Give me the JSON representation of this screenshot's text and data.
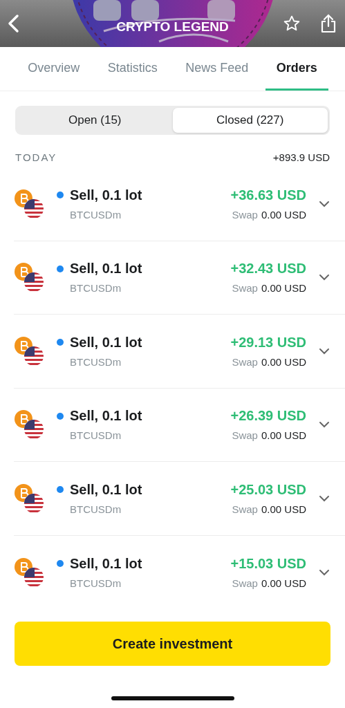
{
  "header": {
    "title": "CRYPTO LEGEND"
  },
  "tabs": [
    {
      "label": "Overview",
      "selected": false
    },
    {
      "label": "Statistics",
      "selected": false
    },
    {
      "label": "News Feed",
      "selected": false
    },
    {
      "label": "Orders",
      "selected": true
    }
  ],
  "segments": [
    {
      "label": "Open (15)",
      "selected": false
    },
    {
      "label": "Closed (227)",
      "selected": true
    }
  ],
  "section": {
    "label": "TODAY",
    "total": "+893.9 USD"
  },
  "orders": [
    {
      "title": "Sell, 0.1 lot",
      "color": "#1e88f0",
      "symbol": "BTCUSDm",
      "profit": "+36.63 USD",
      "swap_label": "Swap",
      "swap_value": "0.00 USD"
    },
    {
      "title": "Sell, 0.1 lot",
      "color": "#1e88f0",
      "symbol": "BTCUSDm",
      "profit": "+32.43 USD",
      "swap_label": "Swap",
      "swap_value": "0.00 USD"
    },
    {
      "title": "Sell, 0.1 lot",
      "color": "#1e88f0",
      "symbol": "BTCUSDm",
      "profit": "+29.13 USD",
      "swap_label": "Swap",
      "swap_value": "0.00 USD"
    },
    {
      "title": "Sell, 0.1 lot",
      "color": "#1e88f0",
      "symbol": "BTCUSDm",
      "profit": "+26.39 USD",
      "swap_label": "Swap",
      "swap_value": "0.00 USD"
    },
    {
      "title": "Sell, 0.1 lot",
      "color": "#1e88f0",
      "symbol": "BTCUSDm",
      "profit": "+25.03 USD",
      "swap_label": "Swap",
      "swap_value": "0.00 USD"
    },
    {
      "title": "Sell, 0.1 lot",
      "color": "#1e88f0",
      "symbol": "BTCUSDm",
      "profit": "+15.03 USD",
      "swap_label": "Swap",
      "swap_value": "0.00 USD"
    }
  ],
  "action_button": {
    "label": "Create investment"
  }
}
